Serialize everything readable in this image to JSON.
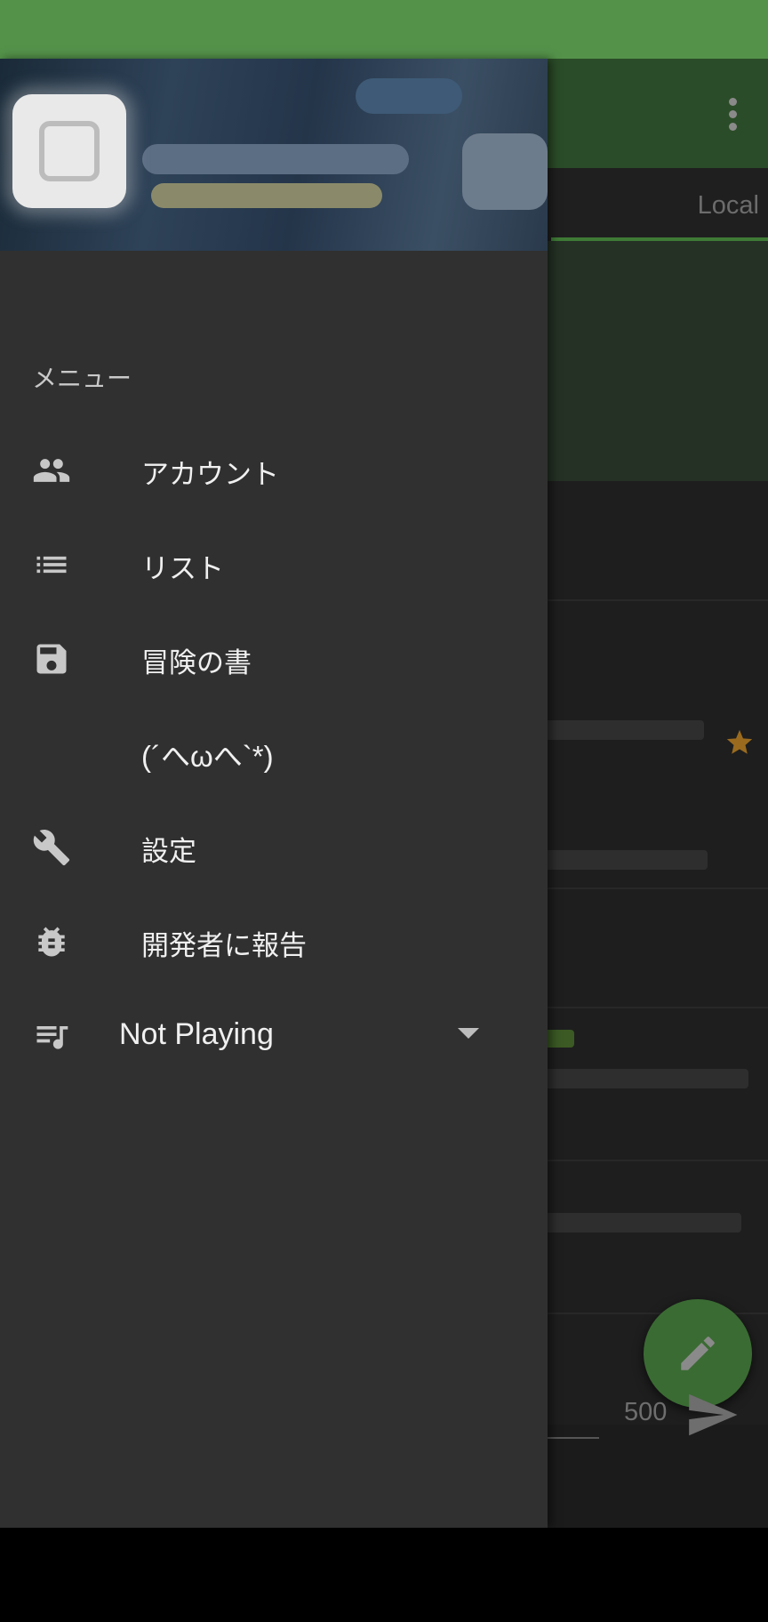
{
  "app": {
    "tab_local": "Local",
    "char_count": "500"
  },
  "drawer": {
    "section_title": "メニュー",
    "items": [
      {
        "label": "アカウント",
        "icon": "people-icon"
      },
      {
        "label": "リスト",
        "icon": "list-icon"
      },
      {
        "label": "冒険の書",
        "icon": "save-icon"
      },
      {
        "label": "(´へωへ`*)",
        "icon": ""
      },
      {
        "label": "設定",
        "icon": "wrench-icon"
      },
      {
        "label": "開発者に報告",
        "icon": "bug-icon"
      }
    ],
    "player": {
      "label": "Not Playing",
      "icon": "queue-music-icon"
    }
  },
  "colors": {
    "status_bar": "#54924a",
    "drawer_bg": "#303030",
    "fab": "#3a6b33",
    "star": "#9a6b1e"
  }
}
